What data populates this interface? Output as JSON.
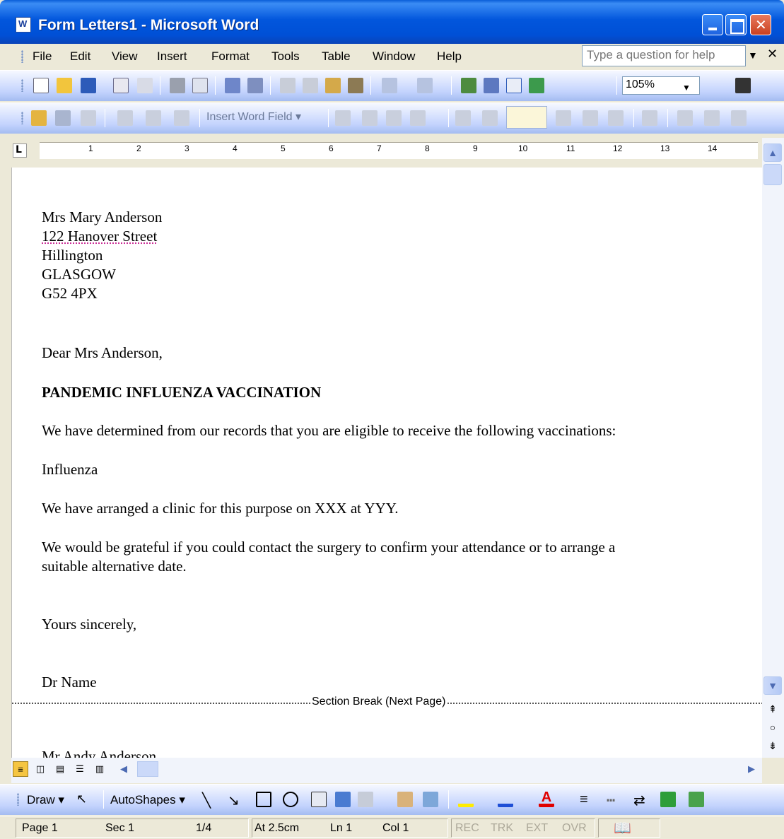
{
  "window": {
    "title": "Form Letters1 - Microsoft Word"
  },
  "menu": {
    "items": [
      "File",
      "Edit",
      "View",
      "Insert",
      "Format",
      "Tools",
      "Table",
      "Window",
      "Help"
    ],
    "help_placeholder": "Type a question for help"
  },
  "toolbar": {
    "zoom": "105%",
    "insert_word_field": "Insert Word Field ▾",
    "draw": "Draw ▾",
    "autoshapes": "AutoShapes ▾"
  },
  "ruler": {
    "numbers": [
      "1",
      "2",
      "3",
      "4",
      "5",
      "6",
      "7",
      "8",
      "9",
      "10",
      "11",
      "12",
      "13",
      "14"
    ]
  },
  "letter": {
    "address": [
      "Mrs Mary Anderson",
      "122 Hanover Street",
      "Hillington",
      "GLASGOW",
      "G52 4PX"
    ],
    "salutation": "Dear Mrs Anderson,",
    "heading": "PANDEMIC INFLUENZA VACCINATION",
    "para1": "We have determined from our records that you are eligible to receive the following vaccinations:",
    "vaccination": "Influenza",
    "para2": "We have arranged a clinic for this purpose on XXX at YYY.",
    "para3_line1": "We would be grateful if you could contact the surgery to confirm your attendance or to arrange a",
    "para3_line2": "suitable alternative date.",
    "closing": "Yours sincerely,",
    "signature": "Dr Name",
    "section_break": "Section Break (Next Page)",
    "next_addressee": "Mr Andy Anderson"
  },
  "status": {
    "page": "Page 1",
    "sec": "Sec 1",
    "page_of": "1/4",
    "at": "At 2.5cm",
    "ln": "Ln 1",
    "col": "Col 1",
    "rec": "REC",
    "trk": "TRK",
    "ext": "EXT",
    "ovr": "OVR"
  },
  "colors": {
    "title_bar": "#0050d6",
    "toolbar": "#c3d3fd",
    "close_button": "#c9401f"
  }
}
